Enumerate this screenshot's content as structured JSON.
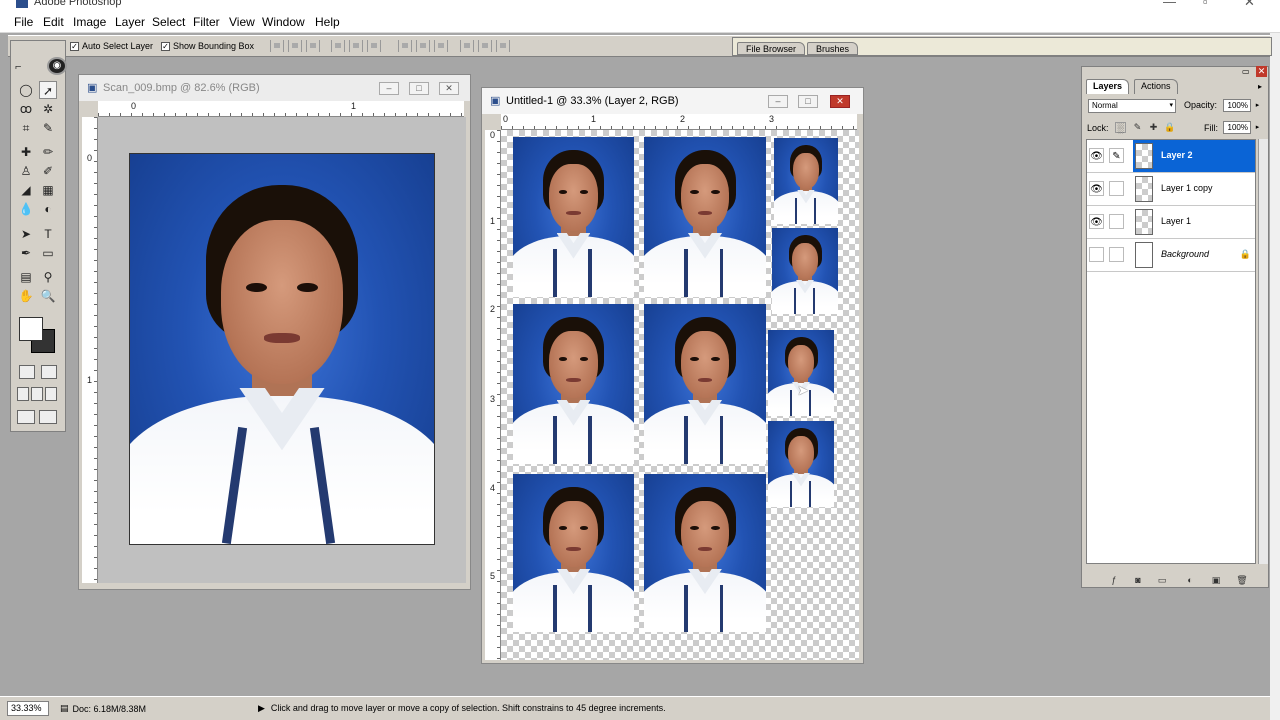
{
  "app": {
    "title": "Adobe Photoshop"
  },
  "menu": [
    "File",
    "Edit",
    "Image",
    "Layer",
    "Select",
    "Filter",
    "View",
    "Window",
    "Help"
  ],
  "options": {
    "auto_select_label": "Auto Select Layer",
    "bounding_box_label": "Show Bounding Box",
    "palette_well_tabs": [
      "File Browser",
      "Brushes"
    ]
  },
  "doc1": {
    "title": "Scan_009.bmp @ 82.6% (RGB)",
    "ruler_h": [
      "0",
      "1"
    ],
    "ruler_v": [
      "0",
      "1"
    ]
  },
  "doc2": {
    "title": "Untitled-1 @ 33.3% (Layer 2, RGB)",
    "ruler_h": [
      "0",
      "1",
      "2",
      "3"
    ],
    "ruler_v": [
      "0",
      "1",
      "2",
      "3",
      "4",
      "5"
    ]
  },
  "layers_palette": {
    "tabs": [
      "Layers",
      "Actions"
    ],
    "blend_mode": "Normal",
    "opacity_label": "Opacity:",
    "opacity_value": "100%",
    "lock_label": "Lock:",
    "fill_label": "Fill:",
    "fill_value": "100%",
    "layers": [
      {
        "name": "Layer 2",
        "visible": true,
        "selected": true
      },
      {
        "name": "Layer 1 copy",
        "visible": true,
        "selected": false
      },
      {
        "name": "Layer 1",
        "visible": true,
        "selected": false
      },
      {
        "name": "Background",
        "visible": false,
        "selected": false,
        "locked": true
      }
    ]
  },
  "status": {
    "zoom": "33.33%",
    "doc_size": "Doc: 6.18M/8.38M",
    "hint": "Click and drag to move layer or move a copy of selection. Shift constrains to 45 degree increments."
  },
  "colors": {
    "selection_blue": "#0a64d6",
    "photo_blue": "#2253b3",
    "panel_gray": "#d4d0c8"
  }
}
